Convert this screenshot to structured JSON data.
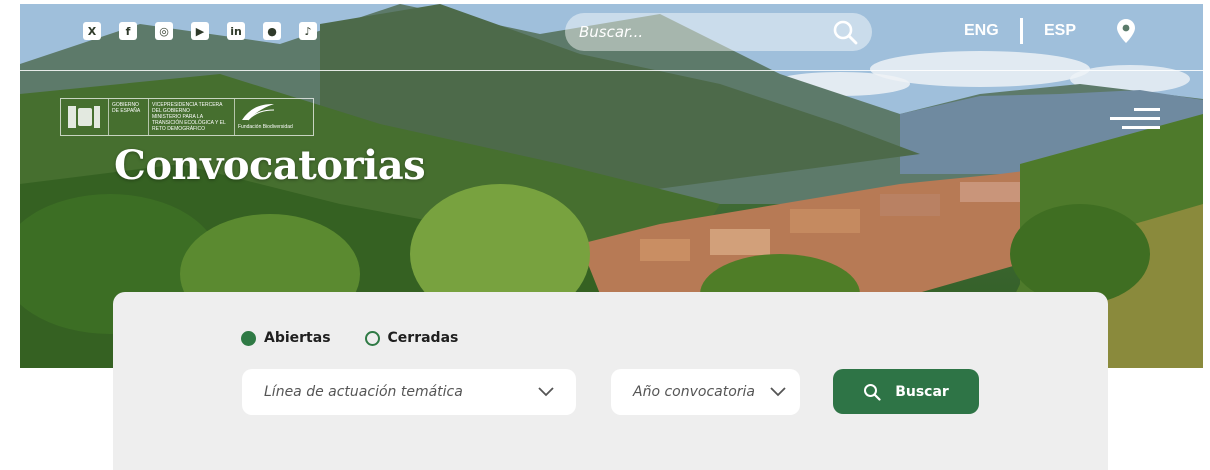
{
  "colors": {
    "brand_green": "#2e7446",
    "panel_bg": "#eeeeee",
    "white": "#ffffff"
  },
  "header": {
    "social_icons": [
      "x-icon",
      "facebook-icon",
      "instagram-icon",
      "youtube-icon",
      "linkedin-icon",
      "podcast-icon",
      "tiktok-icon"
    ],
    "search": {
      "placeholder": "Buscar..."
    },
    "lang_eng": "ENG",
    "lang_esp": "ESP",
    "logos": {
      "gob_text": "GOBIERNO DE ESPAÑA",
      "vice_text": "VICEPRESIDENCIA TERCERA DEL GOBIERNO",
      "min_text": "MINISTERIO PARA LA TRANSICIÓN ECOLÓGICA Y EL RETO DEMOGRÁFICO",
      "fund_text": "Fundación Biodiversidad"
    }
  },
  "hero": {
    "title": "Convocatorias"
  },
  "filters": {
    "status": [
      {
        "label": "Abiertas",
        "selected": true
      },
      {
        "label": "Cerradas",
        "selected": false
      }
    ],
    "theme_placeholder": "Línea de actuación temática",
    "year_placeholder": "Año convocatoria",
    "search_label": "Buscar"
  }
}
